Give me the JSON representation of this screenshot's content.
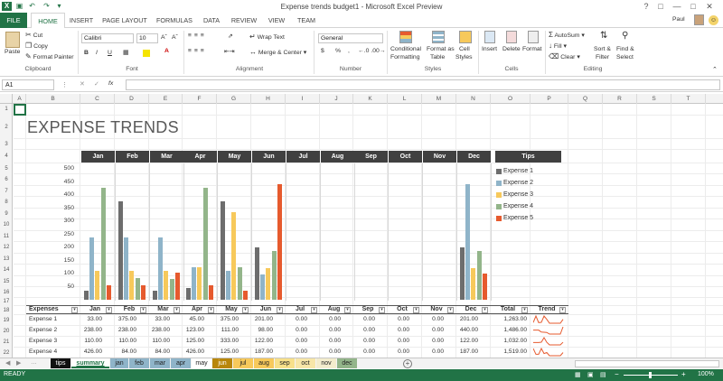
{
  "window": {
    "title": "Expense trends budget1 - Microsoft Excel Preview",
    "user": "Paul"
  },
  "ribbon_tabs": [
    "FILE",
    "HOME",
    "INSERT",
    "PAGE LAYOUT",
    "FORMULAS",
    "DATA",
    "REVIEW",
    "VIEW",
    "TEAM"
  ],
  "active_tab": "HOME",
  "clipboard": {
    "paste": "Paste",
    "cut": "Cut",
    "copy": "Copy",
    "format_painter": "Format Painter",
    "group": "Clipboard"
  },
  "font": {
    "name": "Calibri",
    "size": "10",
    "bold": "B",
    "italic": "I",
    "underline": "U",
    "group": "Font"
  },
  "alignment": {
    "wrap": "Wrap Text",
    "merge": "Merge & Center",
    "group": "Alignment"
  },
  "number": {
    "format": "General",
    "currency": "$",
    "percent": "%",
    "comma": ",",
    "group": "Number"
  },
  "styles": {
    "conditional": "Conditional",
    "conditional2": "Formatting",
    "format_as": "Format as",
    "format_as2": "Table",
    "cell": "Cell",
    "cell2": "Styles",
    "group": "Styles"
  },
  "cells": {
    "insert": "Insert",
    "delete": "Delete",
    "format": "Format",
    "group": "Cells"
  },
  "editing": {
    "autosum": "AutoSum",
    "fill": "Fill",
    "clear": "Clear",
    "sort": "Sort &",
    "sort2": "Filter",
    "find": "Find &",
    "find2": "Select",
    "group": "Editing"
  },
  "formula_bar": {
    "name_box": "A1",
    "fx": "fx",
    "value": ""
  },
  "columns": [
    "A",
    "B",
    "C",
    "D",
    "E",
    "F",
    "G",
    "H",
    "I",
    "J",
    "K",
    "L",
    "M",
    "N",
    "O",
    "P",
    "Q",
    "R",
    "S",
    "T"
  ],
  "rows": [
    "1",
    "2",
    "3",
    "4",
    "5",
    "6",
    "7",
    "8",
    "9",
    "10",
    "11",
    "12",
    "13",
    "14",
    "15",
    "16",
    "17",
    "18",
    "19",
    "20",
    "21",
    "22"
  ],
  "sheet_title": "EXPENSE TRENDS",
  "months": [
    "Jan",
    "Feb",
    "Mar",
    "Apr",
    "May",
    "Jun",
    "Jul",
    "Aug",
    "Sep",
    "Oct",
    "Nov",
    "Dec"
  ],
  "tips_label": "Tips",
  "chart_data": {
    "type": "bar",
    "categories": [
      "Jan",
      "Feb",
      "Mar",
      "Apr",
      "May",
      "Jun",
      "Jul",
      "Aug",
      "Sep",
      "Oct",
      "Nov",
      "Dec"
    ],
    "ylim": [
      0,
      500
    ],
    "yticks": [
      "500",
      "450",
      "400",
      "350",
      "300",
      "250",
      "200",
      "150",
      "100",
      "50"
    ],
    "series": [
      {
        "name": "Expense 1",
        "color": "#6d6d6d",
        "values": [
          33,
          375,
          33,
          45,
          375,
          201,
          0,
          0,
          0,
          0,
          0,
          201
        ]
      },
      {
        "name": "Expense 2",
        "color": "#8fb4c9",
        "values": [
          238,
          238,
          238,
          123,
          111,
          98,
          0,
          0,
          0,
          0,
          0,
          440
        ]
      },
      {
        "name": "Expense 3",
        "color": "#f7c95b",
        "values": [
          110,
          110,
          110,
          125,
          333,
          122,
          0,
          0,
          0,
          0,
          0,
          122
        ]
      },
      {
        "name": "Expense 4",
        "color": "#93b58a",
        "values": [
          426,
          84,
          80,
          426,
          125,
          187,
          0,
          0,
          0,
          0,
          0,
          187
        ]
      },
      {
        "name": "Expense 5",
        "color": "#e65a2e",
        "values": [
          55,
          55,
          105,
          55,
          33,
          440,
          0,
          0,
          0,
          0,
          0,
          100
        ]
      }
    ]
  },
  "table": {
    "headers": [
      "Expenses",
      "Jan",
      "Feb",
      "Mar",
      "Apr",
      "May",
      "Jun",
      "Jul",
      "Aug",
      "Sep",
      "Oct",
      "Nov",
      "Dec",
      "Total",
      "Trend"
    ],
    "rows": [
      {
        "label": "Expense 1",
        "values": [
          "33.00",
          "375.00",
          "33.00",
          "45.00",
          "375.00",
          "201.00",
          "0.00",
          "0.00",
          "0.00",
          "0.00",
          "0.00",
          "201.00"
        ],
        "total": "1,263.00"
      },
      {
        "label": "Expense 2",
        "values": [
          "238.00",
          "238.00",
          "238.00",
          "123.00",
          "111.00",
          "98.00",
          "0.00",
          "0.00",
          "0.00",
          "0.00",
          "0.00",
          "440.00"
        ],
        "total": "1,486.00"
      },
      {
        "label": "Expense 3",
        "values": [
          "110.00",
          "110.00",
          "110.00",
          "125.00",
          "333.00",
          "122.00",
          "0.00",
          "0.00",
          "0.00",
          "0.00",
          "0.00",
          "122.00"
        ],
        "total": "1,032.00"
      },
      {
        "label": "Expense 4",
        "values": [
          "426.00",
          "84.00",
          "84.00",
          "426.00",
          "125.00",
          "187.00",
          "0.00",
          "0.00",
          "0.00",
          "0.00",
          "0.00",
          "187.00"
        ],
        "total": "1,519.00"
      }
    ]
  },
  "sheet_tabs": [
    {
      "label": "tips",
      "bg": "#111111",
      "fg": "#ffffff"
    },
    {
      "label": "summary",
      "bg": "#ffffff",
      "fg": "#217346",
      "active": true
    },
    {
      "label": "jan",
      "bg": "#8fb4c9",
      "fg": "#222222"
    },
    {
      "label": "feb",
      "bg": "#8fb4c9",
      "fg": "#222222"
    },
    {
      "label": "mar",
      "bg": "#8fb4c9",
      "fg": "#222222"
    },
    {
      "label": "apr",
      "bg": "#8fb4c9",
      "fg": "#222222"
    },
    {
      "label": "may",
      "bg": "#ffffff",
      "fg": "#222222"
    },
    {
      "label": "jun",
      "bg": "#b8860b",
      "fg": "#ffffff"
    },
    {
      "label": "jul",
      "bg": "#f7c95b",
      "fg": "#222222"
    },
    {
      "label": "aug",
      "bg": "#f7c95b",
      "fg": "#222222"
    },
    {
      "label": "sep",
      "bg": "#f7e08a",
      "fg": "#222222"
    },
    {
      "label": "oct",
      "bg": "#f7e6a8",
      "fg": "#222222"
    },
    {
      "label": "nov",
      "bg": "#f3eccd",
      "fg": "#222222"
    },
    {
      "label": "dec",
      "bg": "#93b58a",
      "fg": "#222222"
    }
  ],
  "status": {
    "mode": "READY",
    "zoom": "100%"
  },
  "colors": {
    "excel_green": "#217346",
    "header_dark": "#404040"
  }
}
